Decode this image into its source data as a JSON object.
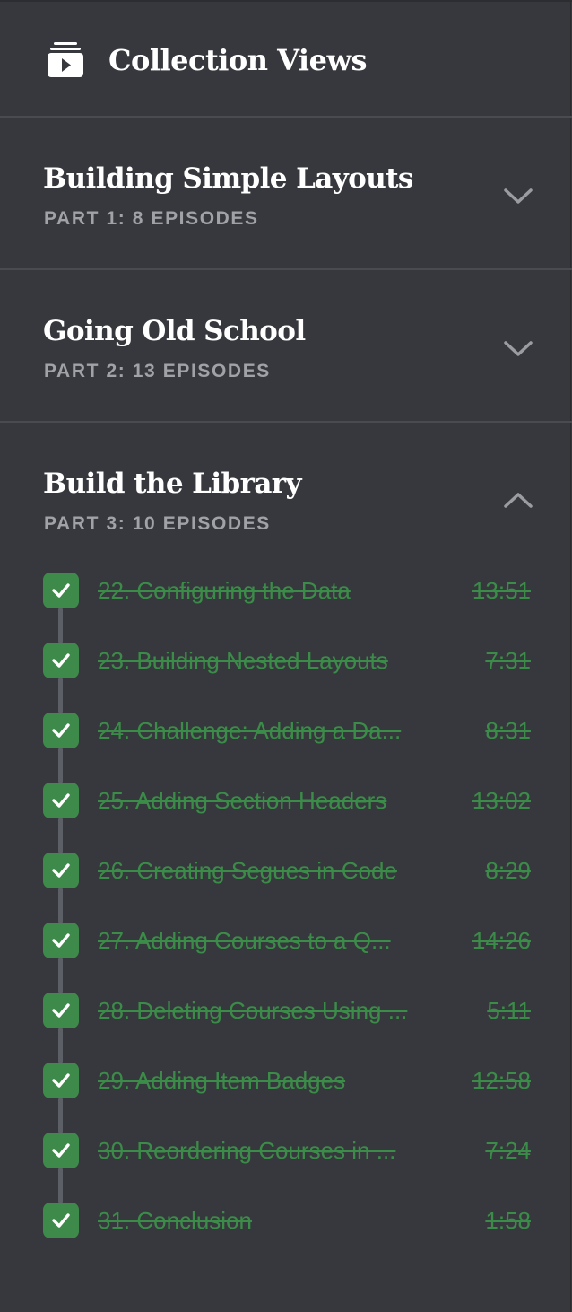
{
  "header": {
    "title": "Collection Views",
    "icon": "video-stack-icon"
  },
  "colors": {
    "background": "#37383d",
    "divider": "#4a4b51",
    "complete": "#3b8c48",
    "subtitle": "#a0a2a8"
  },
  "sections": [
    {
      "title": "Building Simple Layouts",
      "subtitle": "PART 1: 8 EPISODES",
      "expanded": false
    },
    {
      "title": "Going Old School",
      "subtitle": "PART 2: 13 EPISODES",
      "expanded": false
    },
    {
      "title": "Build the Library",
      "subtitle": "PART 3: 10 EPISODES",
      "expanded": true
    }
  ],
  "episodes": [
    {
      "title": "22. Configuring the Data",
      "duration": "13:51",
      "completed": true
    },
    {
      "title": "23. Building Nested Layouts",
      "duration": "7:31",
      "completed": true
    },
    {
      "title": "24. Challenge: Adding a Da...",
      "duration": "8:31",
      "completed": true
    },
    {
      "title": "25. Adding Section Headers",
      "duration": "13:02",
      "completed": true
    },
    {
      "title": "26. Creating Segues in Code",
      "duration": "8:29",
      "completed": true
    },
    {
      "title": "27. Adding Courses to a Q...",
      "duration": "14:26",
      "completed": true
    },
    {
      "title": "28. Deleting Courses Using ...",
      "duration": "5:11",
      "completed": true
    },
    {
      "title": "29. Adding Item Badges",
      "duration": "12:58",
      "completed": true
    },
    {
      "title": "30. Reordering Courses in ...",
      "duration": "7:24",
      "completed": true
    },
    {
      "title": "31. Conclusion",
      "duration": "1:58",
      "completed": true
    }
  ]
}
